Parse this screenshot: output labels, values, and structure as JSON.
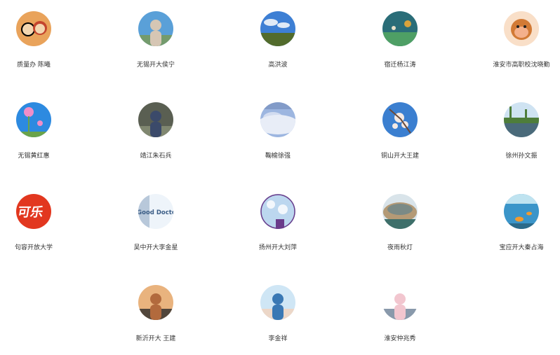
{
  "contacts": [
    {
      "name": "质量办 陈曦",
      "icon": "cartoon-avatar-icon",
      "colors": [
        "#e9a35b",
        "#c4452e",
        "#f3d6b0"
      ]
    },
    {
      "name": "无锡开大侯宁",
      "icon": "portrait-garden-icon",
      "colors": [
        "#5aa0d8",
        "#7a9a52",
        "#d6c6b4"
      ]
    },
    {
      "name": "高洪波",
      "icon": "blue-sky-field-icon",
      "colors": [
        "#3d7fd4",
        "#dfeaf6",
        "#526b2c"
      ]
    },
    {
      "name": "宿迁杨江涛",
      "icon": "underwater-icon",
      "colors": [
        "#2a6d78",
        "#4e9f65",
        "#d9a23b"
      ]
    },
    {
      "name": "淮安市高职校沈晓勤",
      "icon": "monkey-cartoon-icon",
      "colors": [
        "#f9dfc8",
        "#d27a35",
        "#f4b08b"
      ]
    },
    {
      "name": "无锡黄红惠",
      "icon": "pink-flower-icon",
      "colors": [
        "#2d8ae0",
        "#f08ec8",
        "#6aa34a"
      ]
    },
    {
      "name": "靖江朱石兵",
      "icon": "person-street-icon",
      "colors": [
        "#5a5f52",
        "#8a9178",
        "#3b4a6a"
      ]
    },
    {
      "name": "鞠榆徐强",
      "icon": "cloudy-sky-icon",
      "colors": [
        "#9db6e0",
        "#e8edf7",
        "#6f88b8"
      ]
    },
    {
      "name": "铜山开大王建",
      "icon": "cherry-blossom-icon",
      "colors": [
        "#3b7fd0",
        "#f4e9e4",
        "#6a4a3a"
      ]
    },
    {
      "name": "徐州孙文振",
      "icon": "lake-trees-icon",
      "colors": [
        "#cfe3f2",
        "#4e7d3a",
        "#4a6a7a"
      ]
    },
    {
      "name": "句容开放大学",
      "icon": "cola-logo-icon",
      "colors": [
        "#e2371f",
        "#ffffff",
        "#c42812"
      ],
      "logo": "可乐"
    },
    {
      "name": "吴中开大李金星",
      "icon": "good-doctor-icon",
      "colors": [
        "#eef4fa",
        "#3b5d86",
        "#b8c8da"
      ],
      "logo": "Good Doctor"
    },
    {
      "name": "扬州开大刘萍",
      "icon": "sky-building-icon",
      "colors": [
        "#bcd7ef",
        "#ffffff",
        "#6a3b8a"
      ]
    },
    {
      "name": "夜雨秋灯",
      "icon": "rocky-coast-icon",
      "colors": [
        "#7a8a86",
        "#b49a76",
        "#3e6f6a"
      ]
    },
    {
      "name": "宝应开大秦占海",
      "icon": "aquarium-icon",
      "colors": [
        "#3b95c9",
        "#bfe3f0",
        "#f29a2e"
      ]
    },
    {
      "name": "新沂开大 王建",
      "icon": "portrait-man-icon",
      "colors": [
        "#e9b37e",
        "#2b2b2b",
        "#b26a3d"
      ]
    },
    {
      "name": "李金祥",
      "icon": "baby-photo-icon",
      "colors": [
        "#cfe6f5",
        "#f2d3bd",
        "#3a78b4"
      ]
    },
    {
      "name": "淮安仲兆秀",
      "icon": "anime-girl-icon",
      "colors": [
        "#ffffff",
        "#6b7f96",
        "#f2c6cf"
      ]
    }
  ]
}
